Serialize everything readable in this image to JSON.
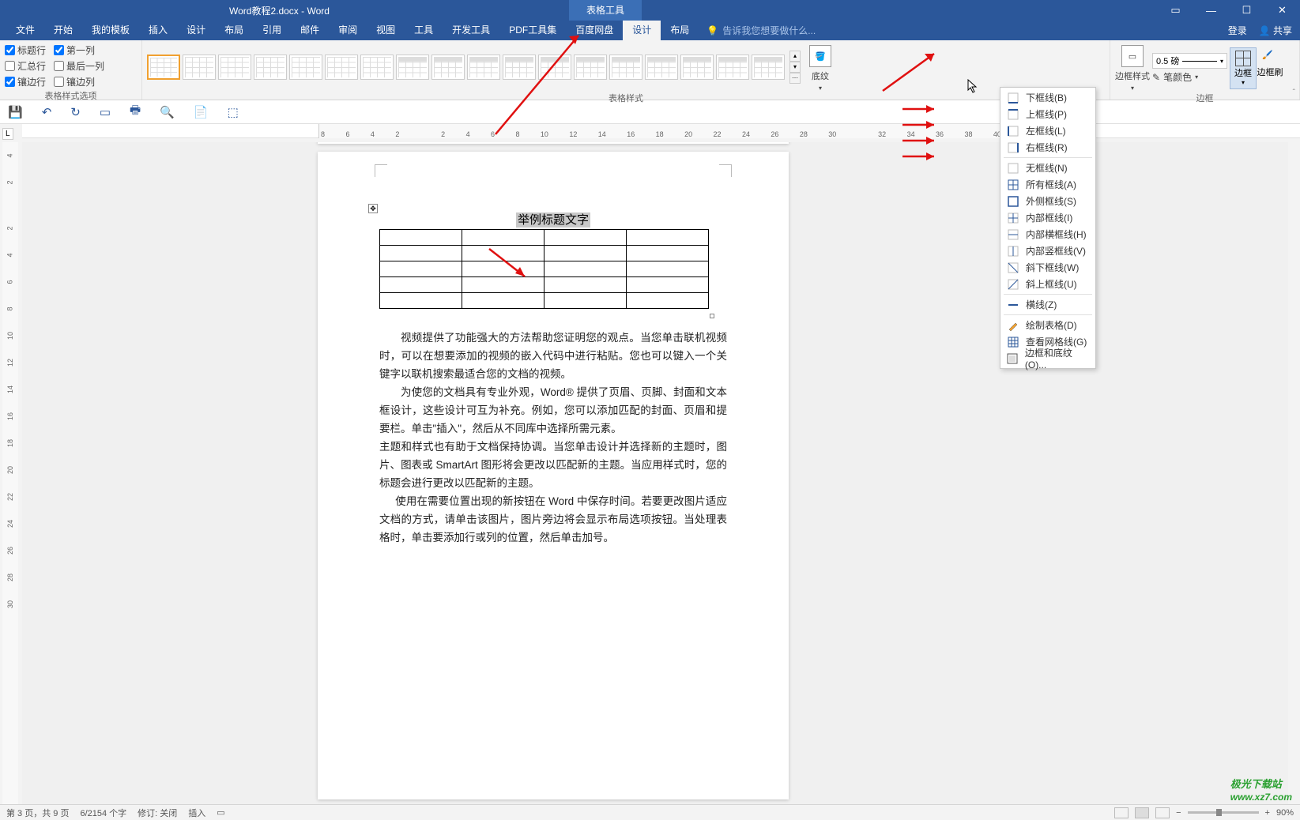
{
  "title": "Word教程2.docx - Word",
  "table_tools": "表格工具",
  "win": {
    "help": "?"
  },
  "menu": {
    "items": [
      "文件",
      "开始",
      "我的模板",
      "插入",
      "设计",
      "布局",
      "引用",
      "邮件",
      "审阅",
      "视图",
      "工具",
      "开发工具",
      "PDF工具集",
      "百度网盘",
      "设计",
      "布局"
    ],
    "active_index": 14,
    "tell_me": "告诉我您想要做什么...",
    "login": "登录",
    "share": "共享"
  },
  "ribbon": {
    "options": {
      "heading_row": "标题行",
      "first_col": "第一列",
      "total_row": "汇总行",
      "last_col": "最后一列",
      "banded_row": "镶边行",
      "banded_col": "镶边列",
      "label": "表格样式选项"
    },
    "styles_label": "表格样式",
    "shading": "底纹",
    "border_style": "边框样式",
    "weight": "0.5 磅",
    "pen_color": "笔颜色",
    "borders_btn": "边框",
    "border_painter": "边框刷",
    "borders_label": "边框"
  },
  "dropdown": [
    {
      "icon": "bottom",
      "label": "下框线(B)"
    },
    {
      "icon": "top",
      "label": "上框线(P)"
    },
    {
      "icon": "left",
      "label": "左框线(L)"
    },
    {
      "icon": "right",
      "label": "右框线(R)"
    },
    {
      "sep": true
    },
    {
      "icon": "none",
      "label": "无框线(N)"
    },
    {
      "icon": "all",
      "label": "所有框线(A)"
    },
    {
      "icon": "outside",
      "label": "外侧框线(S)"
    },
    {
      "icon": "inside",
      "label": "内部框线(I)"
    },
    {
      "icon": "ih",
      "label": "内部横框线(H)"
    },
    {
      "icon": "iv",
      "label": "内部竖框线(V)"
    },
    {
      "icon": "dd",
      "label": "斜下框线(W)"
    },
    {
      "icon": "du",
      "label": "斜上框线(U)"
    },
    {
      "sep": true
    },
    {
      "icon": "hline",
      "label": "横线(Z)"
    },
    {
      "sep": true
    },
    {
      "icon": "draw",
      "label": "绘制表格(D)"
    },
    {
      "icon": "grid",
      "label": "查看网格线(G)"
    },
    {
      "icon": "dlg",
      "label": "边框和底纹(O)..."
    }
  ],
  "ruler_top": [
    "8",
    "6",
    "4",
    "2",
    "",
    "2",
    "4",
    "6",
    "8",
    "10",
    "12",
    "14",
    "16",
    "18",
    "20",
    "22",
    "24",
    "26",
    "28",
    "30",
    "",
    "32",
    "34",
    "36",
    "38",
    "40"
  ],
  "ruler_left": [
    "4",
    "2",
    "",
    "2",
    "4",
    "6",
    "8",
    "10",
    "12",
    "14",
    "16",
    "18",
    "20",
    "22",
    "24",
    "26",
    "28",
    "30"
  ],
  "doc": {
    "title_text": "举例标题文字",
    "p1": "视频提供了功能强大的方法帮助您证明您的观点。当您单击联机视频时，可以在想要添加的视频的嵌入代码中进行粘贴。您也可以键入一个关键字以联机搜索最适合您的文档的视频。",
    "p2": "为使您的文档具有专业外观，Word® 提供了页眉、页脚、封面和文本框设计，这些设计可互为补充。例如，您可以添加匹配的封面、页眉和提要栏。单击\"插入\"，然后从不同库中选择所需元素。",
    "p3a": "主题和样式也有助于文档保持协调。当您单击设计并选择新的主题时，图片、图表或 SmartArt 图形将会更改以匹配新的主题。当应用样式时，您的标题会进行更改以匹配新的主题。",
    "p3b": "使用在需要位置出现的新按钮在 Word 中保存时间。若要更改图片适应文档的方式，请单击该图片，图片旁边将会显示布局选项按钮。当处理表格时，单击要添加行或列的位置，然后单击加号。"
  },
  "status": {
    "page": "第 3 页，共 9 页",
    "words": "6/2154 个字",
    "revise": "修订: 关闭",
    "insert": "插入",
    "zoom": "90%"
  },
  "watermark": {
    "name": "极光下载站",
    "url": "www.xz7.com"
  }
}
